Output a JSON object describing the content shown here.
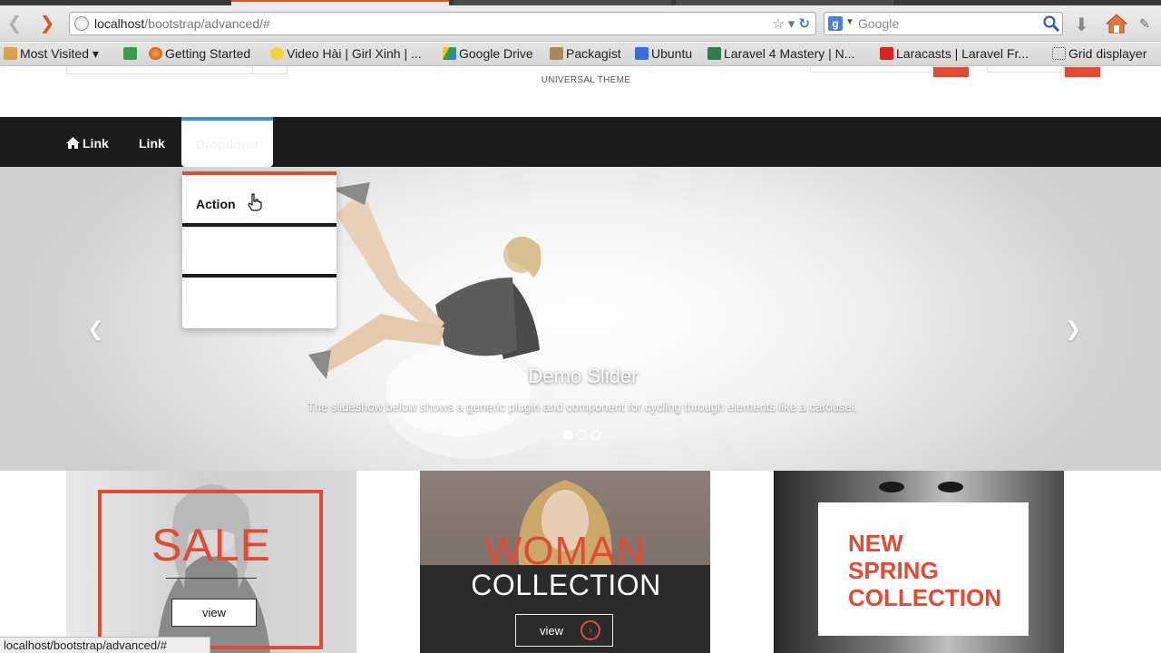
{
  "browser": {
    "url_host": "localhost",
    "url_path": "/bootstrap/advanced/#",
    "search_placeholder": "Google",
    "search_engine_letter": "g",
    "status_url": "localhost/bootstrap/advanced/#",
    "accent_color": "#d9541f"
  },
  "bookmarks": [
    {
      "label": "Most Visited ▾",
      "icon": "folder-icon"
    },
    {
      "label": "Getting Started",
      "icon": "firefox-icon"
    },
    {
      "label": "Video Hài | Girl Xinh | ...",
      "icon": "smiley-icon"
    },
    {
      "label": "Google Drive",
      "icon": "drive-icon"
    },
    {
      "label": "Packagist",
      "icon": "folder-icon"
    },
    {
      "label": "Ubuntu",
      "icon": "doc-icon"
    },
    {
      "label": "Laravel 4 Mastery | N...",
      "icon": "plus-icon"
    },
    {
      "label": "Laracasts | Laravel Fr...",
      "icon": "laracasts-icon"
    },
    {
      "label": "Grid displayer",
      "icon": "dotted-box-icon"
    }
  ],
  "page": {
    "brand": "UNIVERSAL THEME",
    "accent_color": "#e24b32",
    "nav": {
      "home_link": "Link",
      "link2": "Link",
      "dropdown": "Dropdown",
      "dropdown_items": [
        "Action"
      ]
    },
    "slider": {
      "title": "Demo Slider",
      "text": "The slideshow below shows a generic plugin and component for cycling through elements like a carousel.",
      "active_slide": 1,
      "slide_count": 3
    },
    "banners": {
      "sale": {
        "title": "SALE",
        "button": "view"
      },
      "woman": {
        "title": "WOMAN",
        "subtitle": "COLLECTION",
        "button": "view"
      },
      "spring": {
        "line1": "NEW",
        "line2": "SPRING",
        "line3": "COLLECTION"
      }
    }
  }
}
